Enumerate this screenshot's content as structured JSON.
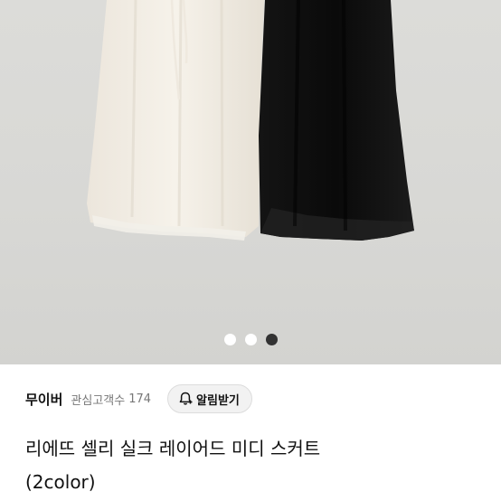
{
  "gallery": {
    "dots": [
      {
        "active": false,
        "color": "#ffffff"
      },
      {
        "active": false,
        "color": "#ffffff"
      },
      {
        "active": true,
        "color": "#333333"
      }
    ]
  },
  "shop": {
    "name": "무이버",
    "favorites_label": "관심고객수",
    "favorites_count": "174",
    "alarm_button_label": "알림받기"
  },
  "product": {
    "title_line1": "리에뜨 셀리 실크 레이어드 미디 스커트",
    "title_line2": "(2color)"
  }
}
